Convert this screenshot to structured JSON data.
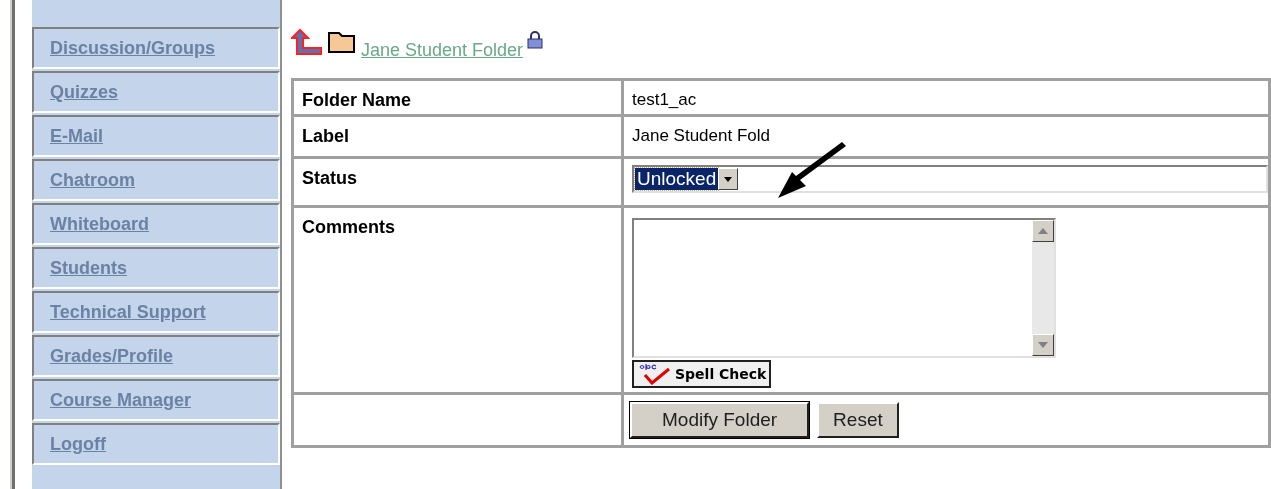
{
  "sidebar": {
    "items": [
      {
        "label": "Discussion/Groups"
      },
      {
        "label": "Quizzes"
      },
      {
        "label": "E-Mail"
      },
      {
        "label": "Chatroom"
      },
      {
        "label": "Whiteboard"
      },
      {
        "label": "Students"
      },
      {
        "label": "Technical Support"
      },
      {
        "label": "Grades/Profile"
      },
      {
        "label": "Course Manager"
      },
      {
        "label": "Logoff"
      }
    ]
  },
  "breadcrumb": {
    "label": "Jane Student Folder"
  },
  "form": {
    "rows": [
      {
        "kind": "text",
        "label": "Folder Name",
        "value": "test1_ac"
      },
      {
        "kind": "text",
        "label": "Label",
        "value": "Jane Student Fold"
      },
      {
        "kind": "select",
        "label": "Status",
        "value": "Unlocked"
      },
      {
        "kind": "textarea",
        "label": "Comments",
        "button": "Spell Check"
      }
    ],
    "buttons": [
      "Modify Folder",
      "Reset"
    ]
  }
}
